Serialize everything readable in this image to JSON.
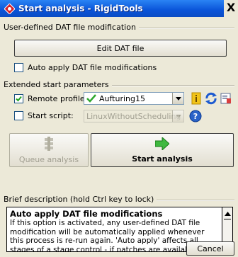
{
  "window": {
    "title": "Start analysis - RigidTools",
    "close_glyph": "X"
  },
  "dat_section": {
    "label": "User-defined DAT file modification",
    "edit_button": "Edit DAT file",
    "auto_apply_label": "Auto apply DAT file modifications",
    "auto_apply_checked": false
  },
  "extended_section": {
    "label": "Extended start parameters",
    "remote_profile_label": "Remote profile:",
    "remote_profile_checked": true,
    "remote_profile_value": "Aufturing15",
    "start_script_label": "Start script:",
    "start_script_checked": false,
    "start_script_value": "LinuxWithoutScheduling"
  },
  "actions": {
    "queue_label": "Queue analysis",
    "start_label": "Start analysis"
  },
  "description": {
    "label": "Brief description (hold Ctrl key to lock)",
    "title": "Auto apply DAT file modifications",
    "text": "If this option is activated, any user-defined DAT file modification will be automatically applied whenever this process is re-run again. 'Auto apply' affects all stages of a stage control - if patches are available for the stages."
  },
  "footer": {
    "cancel_label": "Cancel"
  },
  "icons": [
    "app-diamond-icon",
    "checkmark-icon",
    "info-lightbulb-icon",
    "refresh-icon",
    "properties-icon",
    "help-icon",
    "queue-icon",
    "start-arrow-icon"
  ],
  "colors": {
    "titlebar": "#0a54d8",
    "accent_green": "#2fa82f"
  }
}
